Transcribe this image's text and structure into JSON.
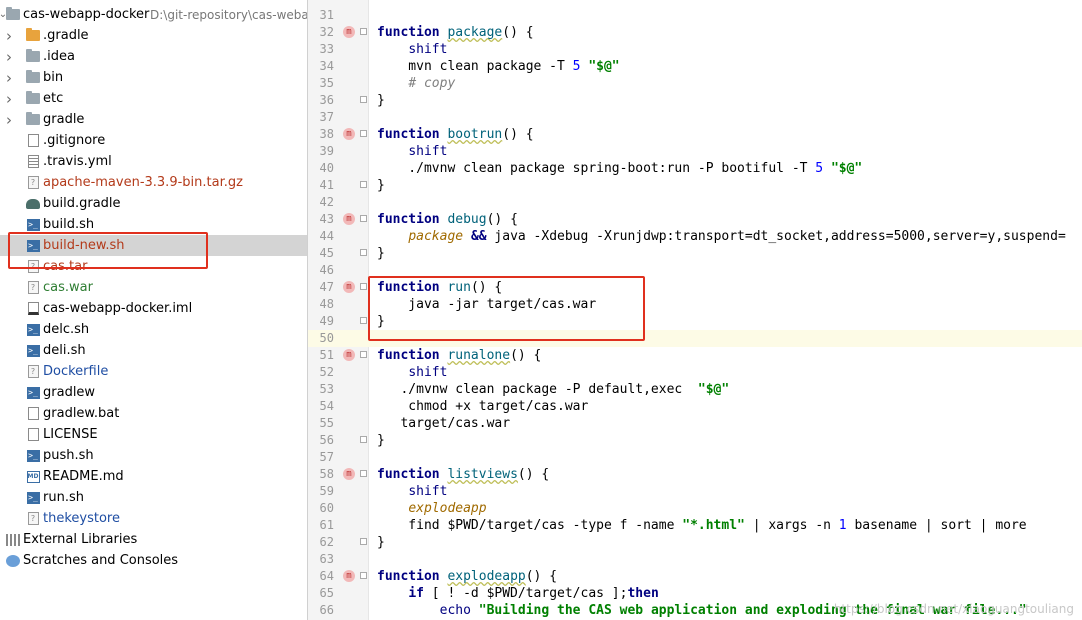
{
  "project": {
    "name": "cas-webapp-docker",
    "path": "D:\\git-repository\\cas-weba"
  },
  "tree": [
    {
      "label": ".gradle",
      "icon": "folder-orange-icon",
      "expandable": true
    },
    {
      "label": ".idea",
      "icon": "folder-icon",
      "expandable": true
    },
    {
      "label": "bin",
      "icon": "folder-icon",
      "expandable": true
    },
    {
      "label": "etc",
      "icon": "folder-icon",
      "expandable": true
    },
    {
      "label": "gradle",
      "icon": "folder-icon",
      "expandable": true
    },
    {
      "label": ".gitignore",
      "icon": "file-icon"
    },
    {
      "label": ".travis.yml",
      "icon": "grid-file-icon"
    },
    {
      "label": "apache-maven-3.3.9-bin.tar.gz",
      "icon": "archive-icon",
      "color": "#b33a1a"
    },
    {
      "label": "build.gradle",
      "icon": "gradle-icon"
    },
    {
      "label": "build.sh",
      "icon": "shell-script-icon"
    },
    {
      "label": "build-new.sh",
      "icon": "shell-script-icon",
      "color": "#b33a1a",
      "selected": true
    },
    {
      "label": "cas.tar",
      "icon": "archive-icon",
      "color": "#b33a1a"
    },
    {
      "label": "cas.war",
      "icon": "archive-icon",
      "color": "#2e7d32"
    },
    {
      "label": "cas-webapp-docker.iml",
      "icon": "module-file-icon"
    },
    {
      "label": "delc.sh",
      "icon": "shell-script-icon"
    },
    {
      "label": "deli.sh",
      "icon": "shell-script-icon"
    },
    {
      "label": "Dockerfile",
      "icon": "unknown-file-icon",
      "color": "#1f4ea3"
    },
    {
      "label": "gradlew",
      "icon": "shell-script-icon"
    },
    {
      "label": "gradlew.bat",
      "icon": "file-icon"
    },
    {
      "label": "LICENSE",
      "icon": "file-icon"
    },
    {
      "label": "push.sh",
      "icon": "shell-script-icon"
    },
    {
      "label": "README.md",
      "icon": "markdown-icon"
    },
    {
      "label": "run.sh",
      "icon": "shell-script-icon"
    },
    {
      "label": "thekeystore",
      "icon": "unknown-file-icon",
      "color": "#1f4ea3"
    }
  ],
  "bottom_nodes": [
    {
      "label": "External Libraries",
      "icon": "libraries-icon"
    },
    {
      "label": "Scratches and Consoles",
      "icon": "scratches-icon"
    }
  ],
  "editor": {
    "watermark": "https://blog.csdn.net/xiaoguangtouliang",
    "lines": [
      {
        "n": "31",
        "tokens": []
      },
      {
        "n": "32",
        "mark": "m",
        "tokens": [
          {
            "t": "function ",
            "c": "kw"
          },
          {
            "t": "package",
            "c": "fn"
          },
          {
            "t": "() {",
            "c": ""
          }
        ]
      },
      {
        "n": "33",
        "tokens": [
          {
            "t": "    ",
            "c": ""
          },
          {
            "t": "shift",
            "c": "sh"
          }
        ]
      },
      {
        "n": "34",
        "tokens": [
          {
            "t": "    mvn clean package -T ",
            "c": ""
          },
          {
            "t": "5",
            "c": "num"
          },
          {
            "t": " ",
            "c": ""
          },
          {
            "t": "\"$@\"",
            "c": "str"
          }
        ]
      },
      {
        "n": "35",
        "tokens": [
          {
            "t": "    ",
            "c": ""
          },
          {
            "t": "# copy",
            "c": "it"
          }
        ]
      },
      {
        "n": "36",
        "fold": true,
        "tokens": [
          {
            "t": "}",
            "c": ""
          }
        ]
      },
      {
        "n": "37",
        "tokens": []
      },
      {
        "n": "38",
        "mark": "m",
        "tokens": [
          {
            "t": "function ",
            "c": "kw"
          },
          {
            "t": "bootrun",
            "c": "fn"
          },
          {
            "t": "() {",
            "c": ""
          }
        ]
      },
      {
        "n": "39",
        "tokens": [
          {
            "t": "    ",
            "c": ""
          },
          {
            "t": "shift",
            "c": "sh"
          }
        ]
      },
      {
        "n": "40",
        "tokens": [
          {
            "t": "    ./mvnw clean package spring-boot:run -P bootiful -T ",
            "c": ""
          },
          {
            "t": "5",
            "c": "num"
          },
          {
            "t": " ",
            "c": ""
          },
          {
            "t": "\"$@\"",
            "c": "str"
          }
        ]
      },
      {
        "n": "41",
        "fold": true,
        "tokens": [
          {
            "t": "}",
            "c": ""
          }
        ]
      },
      {
        "n": "42",
        "tokens": []
      },
      {
        "n": "43",
        "mark": "m",
        "tokens": [
          {
            "t": "function ",
            "c": "kw"
          },
          {
            "t": "debug",
            "c": "fn2"
          },
          {
            "t": "() {",
            "c": ""
          }
        ]
      },
      {
        "n": "44",
        "tokens": [
          {
            "t": "    ",
            "c": ""
          },
          {
            "t": "package",
            "c": "pkg"
          },
          {
            "t": " ",
            "c": ""
          },
          {
            "t": "&&",
            "c": "kw"
          },
          {
            "t": " java -Xdebug -Xrunjdwp:transport=dt_socket,address=5000,server=y,suspend=",
            "c": ""
          }
        ]
      },
      {
        "n": "45",
        "fold": true,
        "tokens": [
          {
            "t": "}",
            "c": ""
          }
        ]
      },
      {
        "n": "46",
        "tokens": []
      },
      {
        "n": "47",
        "mark": "m",
        "tokens": [
          {
            "t": "function ",
            "c": "kw"
          },
          {
            "t": "run",
            "c": "fn2"
          },
          {
            "t": "() {",
            "c": ""
          }
        ]
      },
      {
        "n": "48",
        "tokens": [
          {
            "t": "    java -jar target/cas.war",
            "c": ""
          }
        ]
      },
      {
        "n": "49",
        "fold": true,
        "tokens": [
          {
            "t": "}",
            "c": ""
          }
        ]
      },
      {
        "n": "50",
        "highlight": true,
        "tokens": []
      },
      {
        "n": "51",
        "mark": "m",
        "tokens": [
          {
            "t": "function ",
            "c": "kw"
          },
          {
            "t": "runalone",
            "c": "fn"
          },
          {
            "t": "() {",
            "c": ""
          }
        ]
      },
      {
        "n": "52",
        "tokens": [
          {
            "t": "    ",
            "c": ""
          },
          {
            "t": "shift",
            "c": "sh"
          }
        ]
      },
      {
        "n": "53",
        "tokens": [
          {
            "t": "   ./mvnw clean package -P default,exec  ",
            "c": ""
          },
          {
            "t": "\"$@\"",
            "c": "str"
          }
        ]
      },
      {
        "n": "54",
        "tokens": [
          {
            "t": "    chmod +x target/cas.war",
            "c": ""
          }
        ]
      },
      {
        "n": "55",
        "tokens": [
          {
            "t": "   target/cas.war",
            "c": ""
          }
        ]
      },
      {
        "n": "56",
        "fold": true,
        "tokens": [
          {
            "t": "}",
            "c": ""
          }
        ]
      },
      {
        "n": "57",
        "tokens": []
      },
      {
        "n": "58",
        "mark": "m",
        "tokens": [
          {
            "t": "function ",
            "c": "kw"
          },
          {
            "t": "listviews",
            "c": "fn"
          },
          {
            "t": "() {",
            "c": ""
          }
        ]
      },
      {
        "n": "59",
        "tokens": [
          {
            "t": "    ",
            "c": ""
          },
          {
            "t": "shift",
            "c": "sh"
          }
        ]
      },
      {
        "n": "60",
        "tokens": [
          {
            "t": "    ",
            "c": ""
          },
          {
            "t": "explodeapp",
            "c": "pkg"
          }
        ]
      },
      {
        "n": "61",
        "tokens": [
          {
            "t": "    find $PWD/target/cas -type f -name ",
            "c": ""
          },
          {
            "t": "\"*.html\"",
            "c": "str"
          },
          {
            "t": " | xargs -n ",
            "c": ""
          },
          {
            "t": "1",
            "c": "num"
          },
          {
            "t": " basename | sort | more",
            "c": ""
          }
        ]
      },
      {
        "n": "62",
        "fold": true,
        "tokens": [
          {
            "t": "}",
            "c": ""
          }
        ]
      },
      {
        "n": "63",
        "tokens": []
      },
      {
        "n": "64",
        "mark": "m",
        "tokens": [
          {
            "t": "function ",
            "c": "kw"
          },
          {
            "t": "explodeapp",
            "c": "fn"
          },
          {
            "t": "() {",
            "c": ""
          }
        ]
      },
      {
        "n": "65",
        "tokens": [
          {
            "t": "    ",
            "c": ""
          },
          {
            "t": "if",
            "c": "kw"
          },
          {
            "t": " [ ! -d $PWD/target/cas ];",
            "c": ""
          },
          {
            "t": "then",
            "c": "kw"
          }
        ]
      },
      {
        "n": "66",
        "tokens": [
          {
            "t": "        ",
            "c": ""
          },
          {
            "t": "echo",
            "c": "sh"
          },
          {
            "t": " ",
            "c": ""
          },
          {
            "t": "\"Building the CAS web application and exploding the final war file...\"",
            "c": "str"
          }
        ]
      }
    ]
  }
}
